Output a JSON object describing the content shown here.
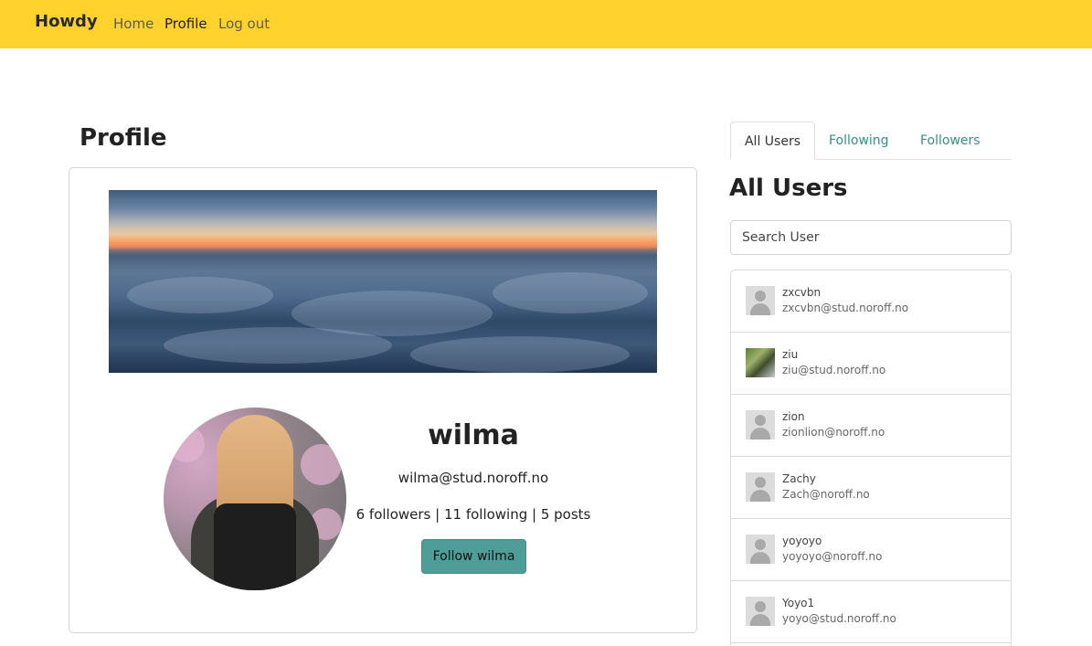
{
  "nav": {
    "brand": "Howdy",
    "links": [
      "Home",
      "Profile",
      "Log out"
    ]
  },
  "profile": {
    "heading": "Profile",
    "name": "wilma",
    "email": "wilma@stud.noroff.no",
    "stats": "6 followers | 11 following | 5 posts",
    "follow_button": "Follow wilma"
  },
  "sidebar": {
    "tabs": [
      "All Users",
      "Following",
      "Followers"
    ],
    "active_tab": "All Users",
    "heading": "All Users",
    "search_placeholder": "Search User",
    "users": [
      {
        "name": "zxcvbn",
        "email": "zxcvbn@stud.noroff.no",
        "avatar": "default-avatar-icon"
      },
      {
        "name": "ziu",
        "email": "ziu@stud.noroff.no",
        "avatar": "photo"
      },
      {
        "name": "zion",
        "email": "zionlion@noroff.no",
        "avatar": "default-avatar-icon"
      },
      {
        "name": "Zachy",
        "email": "Zach@noroff.no",
        "avatar": "default-avatar-icon"
      },
      {
        "name": "yoyoyo",
        "email": "yoyoyo@noroff.no",
        "avatar": "default-avatar-icon"
      },
      {
        "name": "Yoyo1",
        "email": "yoyo@stud.noroff.no",
        "avatar": "default-avatar-icon"
      }
    ]
  },
  "colors": {
    "navbar": "#ffd22e",
    "accent": "#4f9d98",
    "tab_link": "#3a8c88"
  }
}
